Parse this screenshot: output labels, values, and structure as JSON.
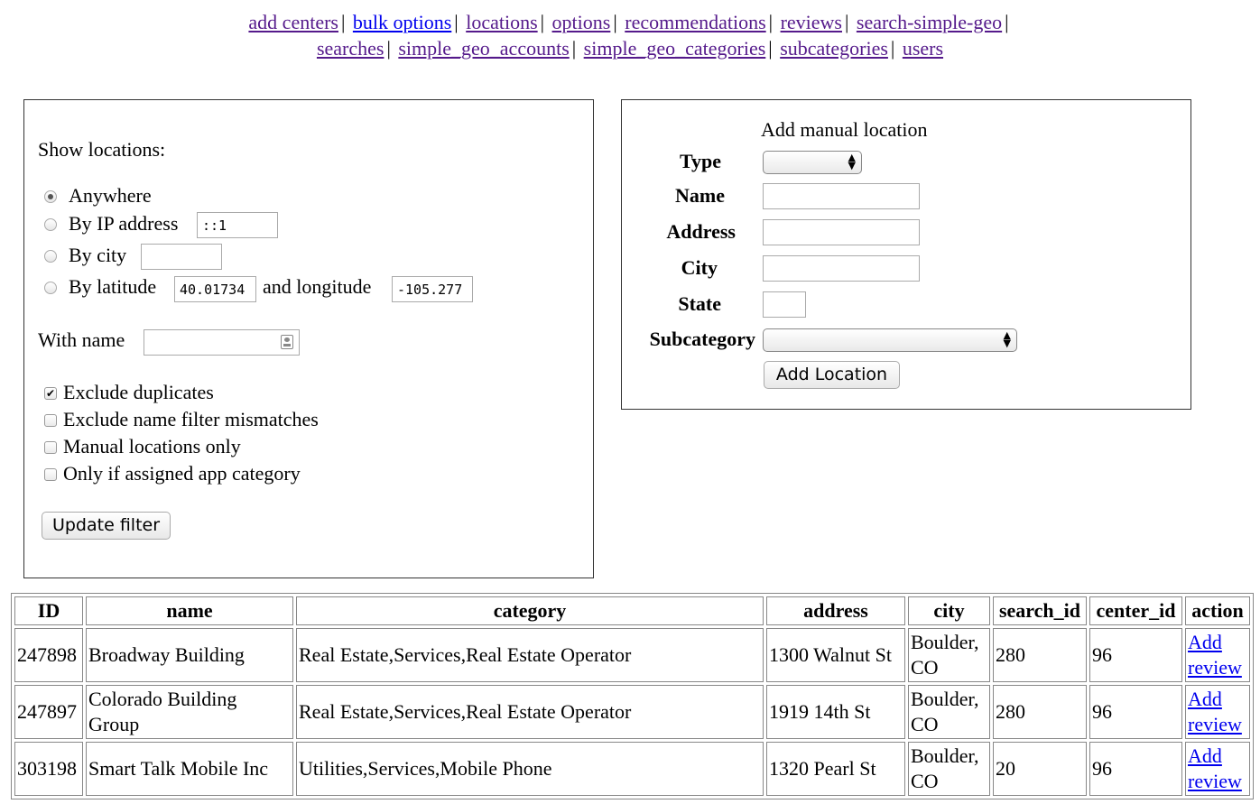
{
  "nav": {
    "row1": [
      "add centers",
      "bulk options",
      "locations",
      "options",
      "recommendations",
      "reviews",
      "search-simple-geo"
    ],
    "row2": [
      "searches",
      "simple_geo_accounts",
      "simple_geo_categories",
      "subcategories",
      "users"
    ]
  },
  "filter": {
    "heading": "Show locations:",
    "anywhere": "Anywhere",
    "by_ip": "By IP address",
    "ip_value": "::1",
    "by_city": "By city",
    "city_value": "",
    "by_lat": "By latitude",
    "lat_value": "40.01734",
    "and_lon": "and longitude",
    "lon_value": "-105.277",
    "with_name": "With name",
    "exclude_duplicates": "Exclude duplicates",
    "exclude_mismatches": "Exclude name filter mismatches",
    "manual_only": "Manual locations only",
    "assigned_only": "Only if assigned app category",
    "update_button": "Update filter"
  },
  "manual": {
    "title": "Add manual location",
    "type_label": "Type",
    "name_label": "Name",
    "address_label": "Address",
    "city_label": "City",
    "state_label": "State",
    "subcategory_label": "Subcategory",
    "add_button": "Add Location"
  },
  "table": {
    "headers": [
      "ID",
      "name",
      "category",
      "address",
      "city",
      "search_id",
      "center_id",
      "action"
    ],
    "rows": [
      {
        "id": "247898",
        "name": "Broadway Building",
        "category": "Real Estate,Services,Real Estate Operator",
        "address": "1300 Walnut St",
        "city": "Boulder, CO",
        "search_id": "280",
        "center_id": "96",
        "action": "Add review"
      },
      {
        "id": "247897",
        "name": "Colorado Building Group",
        "category": "Real Estate,Services,Real Estate Operator",
        "address": "1919 14th St",
        "city": "Boulder, CO",
        "search_id": "280",
        "center_id": "96",
        "action": "Add review"
      },
      {
        "id": "303198",
        "name": "Smart Talk Mobile Inc",
        "category": "Utilities,Services,Mobile Phone",
        "address": "1320 Pearl St",
        "city": "Boulder, CO",
        "search_id": "20",
        "center_id": "96",
        "action": "Add review"
      }
    ]
  },
  "colors": {
    "link_visited": "#551a8b",
    "link": "#0000ee",
    "border": "#333333"
  }
}
